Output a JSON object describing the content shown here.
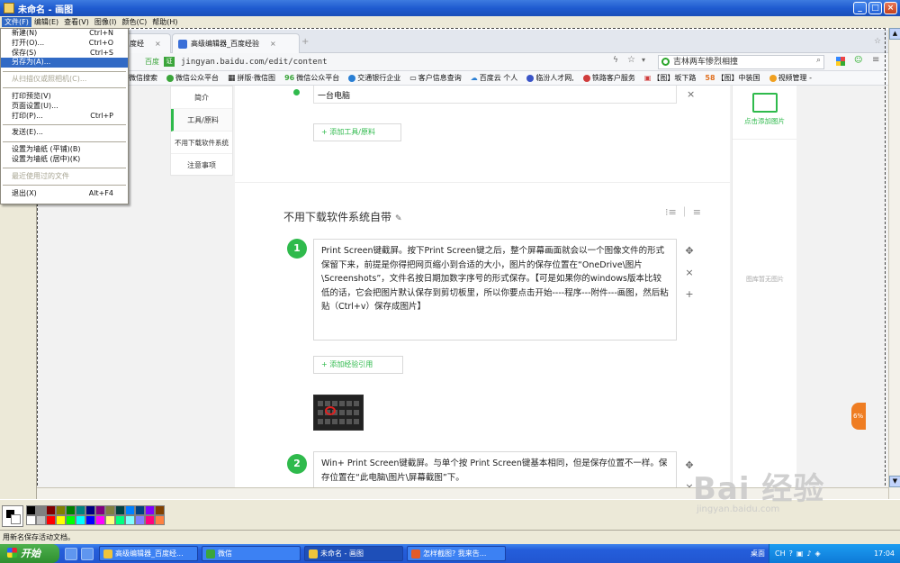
{
  "window": {
    "title": "未命名 - 画图",
    "min": "_",
    "max": "□",
    "close": "×"
  },
  "menubar": [
    "文件(F)",
    "编辑(E)",
    "查看(V)",
    "图像(I)",
    "颜色(C)",
    "帮助(H)"
  ],
  "file_menu": {
    "new": {
      "label": "新建(N)",
      "shortcut": "Ctrl+N"
    },
    "open": {
      "label": "打开(O)...",
      "shortcut": "Ctrl+O"
    },
    "save": {
      "label": "保存(S)",
      "shortcut": "Ctrl+S"
    },
    "save_as": {
      "label": "另存为(A)..."
    },
    "scan": {
      "label": "从扫描仪或照相机(C)..."
    },
    "print_preview": {
      "label": "打印预览(V)"
    },
    "page_setup": {
      "label": "页面设置(U)..."
    },
    "print": {
      "label": "打印(P)...",
      "shortcut": "Ctrl+P"
    },
    "send": {
      "label": "发送(E)..."
    },
    "wallpaper_tile": {
      "label": "设置为墙纸 (平铺)(B)"
    },
    "wallpaper_center": {
      "label": "设置为墙纸 (居中)(K)"
    },
    "recent": {
      "label": "最近使用过的文件"
    },
    "exit": {
      "label": "退出(X)",
      "shortcut": "Alt+F4"
    }
  },
  "browser": {
    "tab1": {
      "label": "度经",
      "close": "×"
    },
    "tab2": {
      "label": "高级编辑器_百度经验",
      "close": "×"
    },
    "new_tab": "+",
    "baidu_tag": "百度",
    "url": "jingyan.baidu.com/edit/content",
    "search_value": "吉林两车惨烈相撞",
    "bookmarks": [
      "微信搜索",
      "微信公众平台",
      "拼版·微信图",
      "微信公众平台",
      "交通银行企业",
      "客户信息查询",
      "百度云 个人",
      "临汾人才网,",
      "铁路客户服务",
      "【图】坂下路",
      "【图】中装国",
      "视频管理 -"
    ],
    "bm_prefix": [
      "",
      "",
      "",
      "96",
      "",
      "",
      "",
      "",
      "",
      "",
      "58",
      ""
    ]
  },
  "editor": {
    "nav": [
      "简介",
      "工具/原料",
      "不用下载软件系统",
      "注意事项"
    ],
    "tool_item": "一台电脑",
    "add_tool": "+ 添加工具/原料",
    "section_title": "不用下载软件系统自带",
    "steps": [
      {
        "num": "1",
        "text": "Print Screen键截屏。按下Print Screen键之后，整个屏幕画面就会以一个图像文件的形式保留下来，前提是你得把网页缩小到合适的大小，图片的保存位置在“OneDrive\\图片\\Screenshots”，文件名按日期加数字序号的形式保存。【可是如果你的windows版本比较低的话，它会把图片默认保存到剪切板里，所以你要点击开始----程序---附件---画图，然后粘贴（Ctrl+v）保存成图片】"
      },
      {
        "num": "2",
        "text": "Win+ Print Screen键截屏。与单个按 Print Screen键基本相同，但是保存位置不一样。保存位置在“此电脑\\图片\\屏幕截图”下。"
      }
    ],
    "add_ref": "+ 添加经验引用",
    "right_add_image": "点击添加图片",
    "right_empty": "图库暂无图片",
    "badge": "6%"
  },
  "palette": [
    "#000000",
    "#808080",
    "#800000",
    "#808000",
    "#008000",
    "#008080",
    "#000080",
    "#800080",
    "#808040",
    "#004040",
    "#0080ff",
    "#004080",
    "#8000ff",
    "#804000",
    "#ffffff",
    "#c0c0c0",
    "#ff0000",
    "#ffff00",
    "#00ff00",
    "#00ffff",
    "#0000ff",
    "#ff00ff",
    "#ffff80",
    "#00ff80",
    "#80ffff",
    "#8080ff",
    "#ff0080",
    "#ff8040"
  ],
  "status": "用新名保存活动文档。",
  "taskbar": {
    "start": "开始",
    "buttons": [
      "高级编辑器_百度经...",
      "微信",
      "未命名 - 画图",
      "怎样截图? 我来告..."
    ],
    "desktop": "桌面",
    "ime": "CH",
    "clock": "17:04"
  },
  "watermark": {
    "big": "Bai 经验",
    "small": "jingyan.baidu.com"
  }
}
